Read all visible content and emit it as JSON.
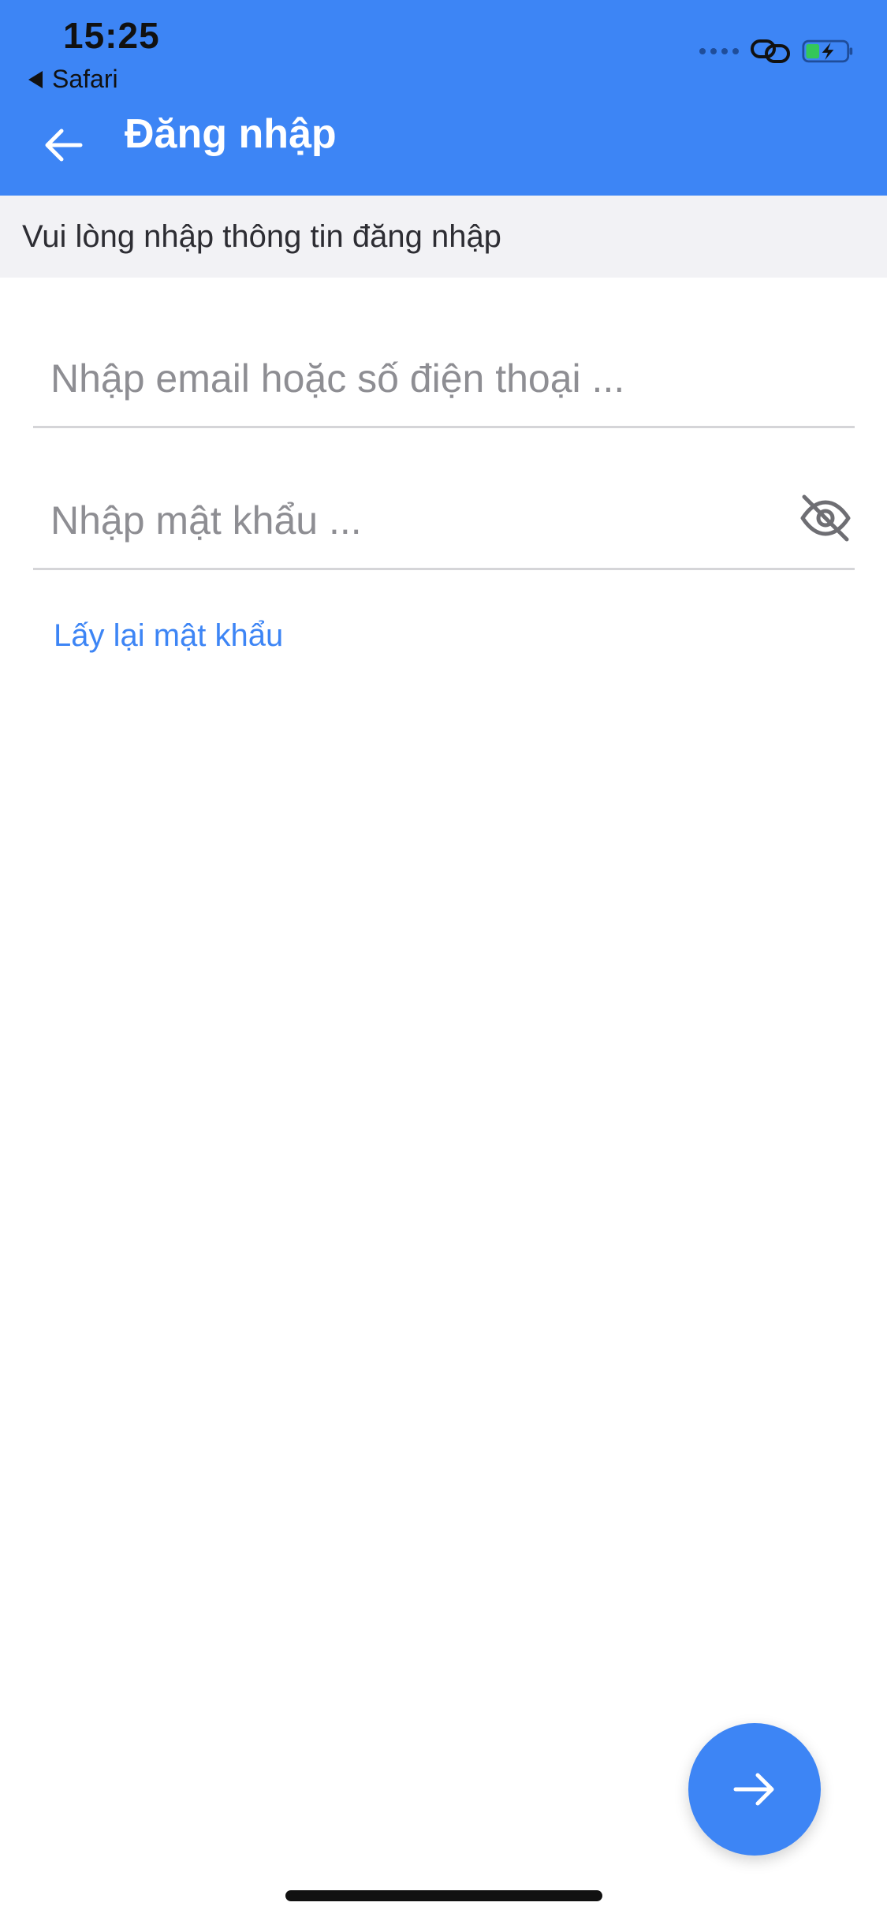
{
  "status_bar": {
    "time": "15:25",
    "back_app_label": "Safari",
    "icons": [
      "signal-dots-icon",
      "link-icon",
      "battery-charging-icon"
    ]
  },
  "app_bar": {
    "title": "Đăng nhập",
    "back_icon": "arrow-left-icon"
  },
  "sub_header": {
    "text": "Vui lòng nhập thông tin đăng nhập"
  },
  "form": {
    "email": {
      "value": "",
      "placeholder": "Nhập email hoặc số điện thoại ..."
    },
    "password": {
      "value": "",
      "placeholder": "Nhập mật khẩu ...",
      "toggle_icon": "eye-off-icon"
    },
    "forgot_password_label": "Lấy lại mật khẩu",
    "submit_icon": "arrow-right-icon"
  },
  "colors": {
    "primary": "#3d85f5",
    "sub_header_bg": "#f2f2f5",
    "placeholder": "#8e8e93",
    "divider": "#d5d5d8"
  }
}
